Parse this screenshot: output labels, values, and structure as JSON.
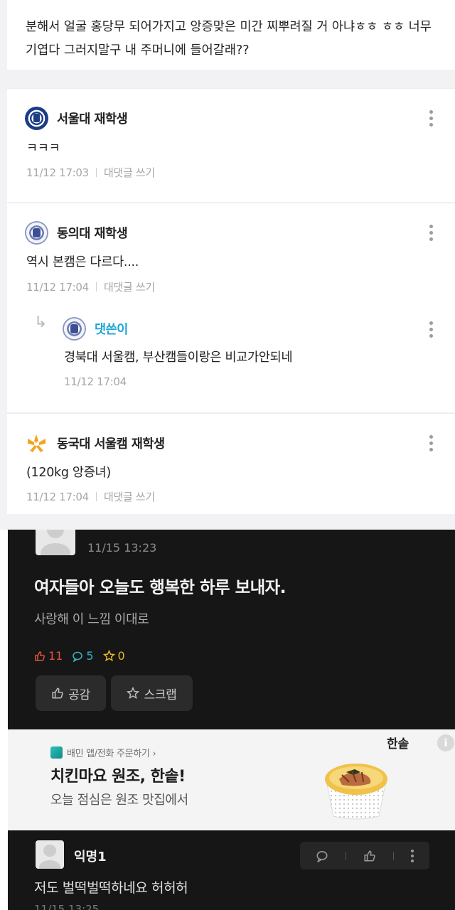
{
  "top": {
    "post_text": "분해서 얼굴 홍당무 되어가지고 앙증맞은 미간 찌뿌려질 거 아냐ㅎㅎ ㅎㅎ 너무 기엽다 그러지말구 내 주머니에 들어갈래??",
    "comments": [
      {
        "nickname": "서울대 재학생",
        "logo": "snu-logo-icon",
        "body": "ㅋㅋㅋ",
        "time": "11/12 17:03",
        "reply_label": "대댓글 쓰기"
      },
      {
        "nickname": "동의대 재학생",
        "logo": "deu-logo-icon",
        "body": "역시 본캠은 다르다....",
        "time": "11/12 17:04",
        "reply_label": "대댓글 쓰기",
        "reply": {
          "nickname": "댓쓴이",
          "body": "경북대 서울캠, 부산캠들이랑은 비교가안되네",
          "time": "11/12 17:04"
        }
      },
      {
        "nickname": "동국대 서울캠 재학생",
        "logo": "dgu-logo-icon",
        "body": "(120kg 앙증녀)",
        "time": "11/12 17:04",
        "reply_label": "대댓글 쓰기"
      }
    ]
  },
  "bottom": {
    "post_time": "11/15 13:23",
    "title": "여자들아 오늘도 행복한 하루 보내자.",
    "subtitle": "사랑해 이 느낌 이대로",
    "stats": {
      "likes": "11",
      "comments": "5",
      "scraps": "0"
    },
    "colors": {
      "like": "#e0523a",
      "comment": "#32b6c6",
      "scrap": "#e6b422"
    },
    "buttons": {
      "like_label": "공감",
      "scrap_label": "스크랩"
    },
    "ad": {
      "source": "배민 앱/전화 주문하기 ›",
      "title": "치킨마요 원조, 한솥!",
      "description": "오늘 점심은 원조 맛집에서",
      "brand": "한솥",
      "info": "i"
    },
    "comment": {
      "nickname": "익명1",
      "body": "저도 벌떡벌떡하네요 허허허",
      "time": "11/15 13:25"
    }
  }
}
